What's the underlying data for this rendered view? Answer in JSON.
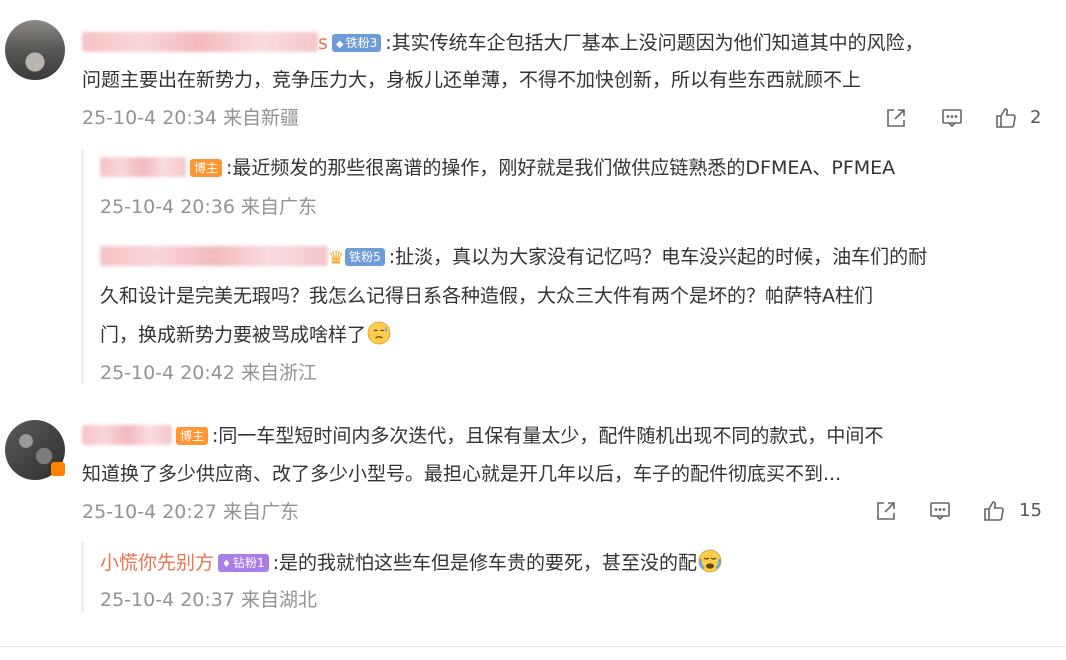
{
  "comments": [
    {
      "name_suffix": "s",
      "badge": "铁粉3",
      "text_line1": ":其实传统车企包括大厂基本上没问题因为他们知道其中的风险，",
      "text_line2": "问题主要出在新势力，竞争压力大，身板儿还单薄，不得不加快创新，所以有些东西就顾不上",
      "time": "25-10-4 20:34 来自新疆",
      "likes": "2",
      "replies": [
        {
          "badge": "博主",
          "text": ":最近频发的那些很离谱的操作，刚好就是我们做供应链熟悉的DFMEA、PFMEA",
          "time": "25-10-4 20:36 来自广东"
        },
        {
          "badge": "铁粉5",
          "text_line1": ":扯淡，真以为大家没有记忆吗？电车没兴起的时候，油车们的耐",
          "text_line2": "久和设计是完美无瑕吗？我怎么记得日系各种造假，大众三大件有两个是坏的？帕萨特A柱们",
          "text_line3": "门，换成新势力要被骂成啥样了",
          "time": "25-10-4 20:42 来自浙江"
        }
      ]
    },
    {
      "badge": "博主",
      "text_line1": ":同一车型短时间内多次迭代，且保有量太少，配件随机出现不同的款式，中间不",
      "text_line2": "知道换了多少供应商、改了多少小型号。最担心就是开几年以后，车子的配件彻底买不到...",
      "time": "25-10-4 20:27 来自广东",
      "likes": "15",
      "replies": [
        {
          "name": "小慌你先别方",
          "badge": "钻粉1",
          "text": ":是的我就怕这些车但是修车贵的要死，甚至没的配",
          "time": "25-10-4 20:37 来自湖北"
        }
      ]
    }
  ],
  "icons": {
    "share": "share-icon",
    "comment": "comment-icon",
    "like": "thumbs-up-icon"
  },
  "colors": {
    "name": "#eb7350",
    "time": "#939393",
    "iron_badge": "#6f9bd8",
    "bozhu_badge": "#ff9632",
    "diamond_badge": "#a97ee9"
  }
}
